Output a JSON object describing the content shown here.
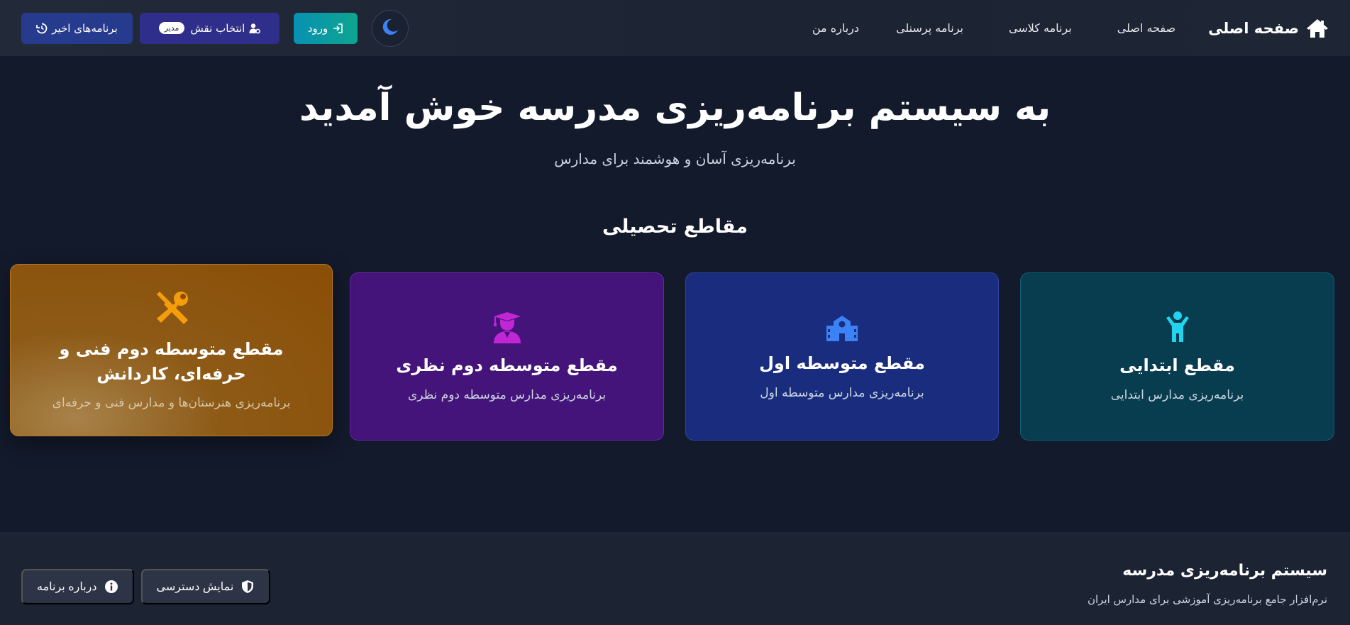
{
  "navbar": {
    "brand": "صفحه اصلی",
    "links": [
      "صفحه اصلی",
      "برنامه کلاسی",
      "برنامه پرسنلی",
      "درباره من"
    ],
    "login_label": "ورود",
    "role_label": "انتخاب نقش",
    "role_badge": "مدیر",
    "recent_label": "برنامه‌های اخیر",
    "icons": {
      "brand": "home-icon",
      "login": "sign-in-icon",
      "role": "user-cog-icon",
      "recent": "history-icon",
      "theme": "moon-icon"
    }
  },
  "hero": {
    "title": "به سیستم برنامه‌ریزی مدرسه خوش آمدید",
    "subtitle": "برنامه‌ریزی آسان و هوشمند برای مدارس"
  },
  "section": {
    "title": "مقاطع تحصیلی"
  },
  "cards": [
    {
      "title": "مقطع ابتدایی",
      "desc": "برنامه‌ریزی مدارس ابتدایی",
      "icon": "child-icon",
      "color": "#073d4f",
      "icon_color": "#22d3ee"
    },
    {
      "title": "مقطع متوسطه اول",
      "desc": "برنامه‌ریزی مدارس متوسطه اول",
      "icon": "school-icon",
      "color": "#1a2c7e",
      "icon_color": "#3b82f6"
    },
    {
      "title": "مقطع متوسطه دوم نظری",
      "desc": "برنامه‌ریزی مدارس متوسطه دوم نظری",
      "icon": "graduate-icon",
      "color": "#44147a",
      "icon_color": "#c026d3"
    },
    {
      "title": "مقطع متوسطه دوم فنی و حرفه‌ای، کاردانش",
      "desc": "برنامه‌ریزی هنرستان‌ها و مدارس فنی و حرفه‌ای",
      "icon": "tools-icon",
      "color": "#8a4e06",
      "icon_color": "#f59e0b"
    }
  ],
  "footer": {
    "title": "سیستم برنامه‌ریزی مدرسه",
    "subtitle": "نرم‌افزار جامع برنامه‌ریزی آموزشی برای مدارس ایران",
    "access_label": "نمایش دسترسی",
    "about_label": "درباره برنامه",
    "icons": {
      "access": "shield-icon",
      "about": "info-icon"
    }
  }
}
